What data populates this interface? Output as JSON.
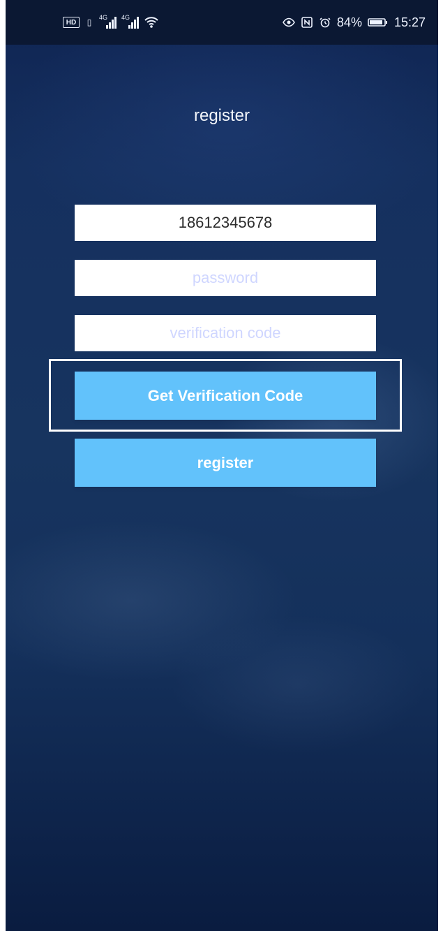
{
  "status_bar": {
    "left_icons": {
      "hd": "HD",
      "sim_tag_1": "4G",
      "sim_tag_2": "4G"
    },
    "battery_percent": "84%",
    "time": "15:27"
  },
  "screen": {
    "title": "register"
  },
  "form": {
    "phone_value": "18612345678",
    "password_placeholder": "password",
    "verification_placeholder": "verification code",
    "get_code_label": "Get Verification Code",
    "register_label": "register"
  },
  "colors": {
    "accent": "#62c2fb",
    "placeholder": "#cfd6ff",
    "background_top": "#0f2452",
    "background_bottom": "#0a1c40"
  },
  "icons": {
    "status": [
      "hd-icon",
      "signal-icon",
      "signal-icon",
      "wifi-icon",
      "eye-icon",
      "nfc-icon",
      "alarm-icon",
      "battery-icon"
    ]
  }
}
